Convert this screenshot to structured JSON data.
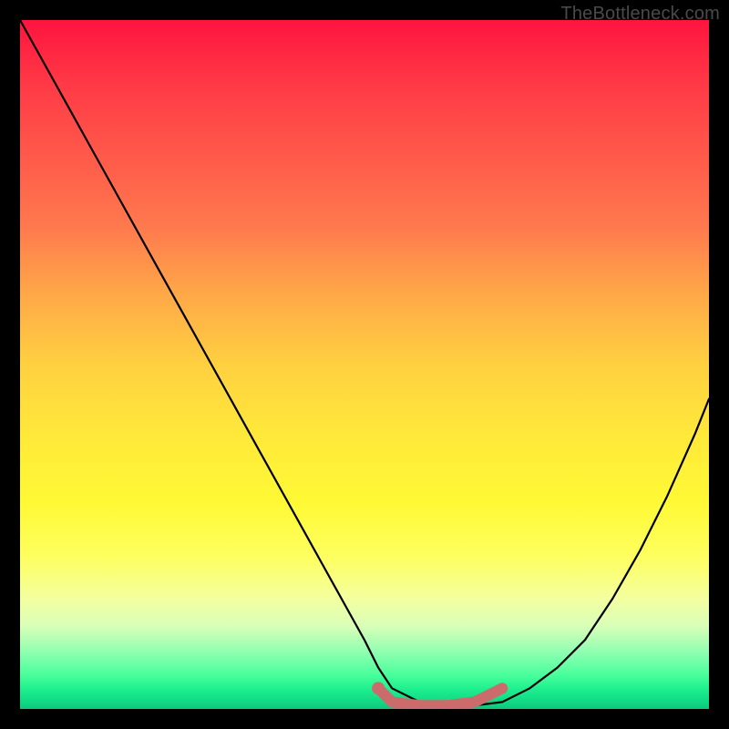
{
  "watermark": "TheBottleneck.com",
  "chart_data": {
    "type": "line",
    "title": "",
    "xlabel": "",
    "ylabel": "",
    "xlim": [
      0,
      100
    ],
    "ylim": [
      0,
      100
    ],
    "series": [
      {
        "name": "bottleneck-curve",
        "x": [
          0,
          5,
          10,
          15,
          20,
          25,
          30,
          35,
          40,
          45,
          50,
          52,
          54,
          58,
          62,
          66,
          70,
          74,
          78,
          82,
          86,
          90,
          94,
          98,
          100
        ],
        "y": [
          100,
          91,
          82,
          73,
          64,
          55,
          46,
          37,
          28,
          19,
          10,
          6,
          3,
          1,
          0.5,
          0.5,
          1,
          3,
          6,
          10,
          16,
          23,
          31,
          40,
          45
        ]
      },
      {
        "name": "optimal-highlight",
        "x": [
          52,
          54,
          58,
          62,
          66,
          70
        ],
        "y": [
          3,
          1,
          0.5,
          0.5,
          1,
          3
        ]
      }
    ],
    "annotations": []
  },
  "colors": {
    "curve": "#000000",
    "highlight": "#cc6b6b"
  }
}
